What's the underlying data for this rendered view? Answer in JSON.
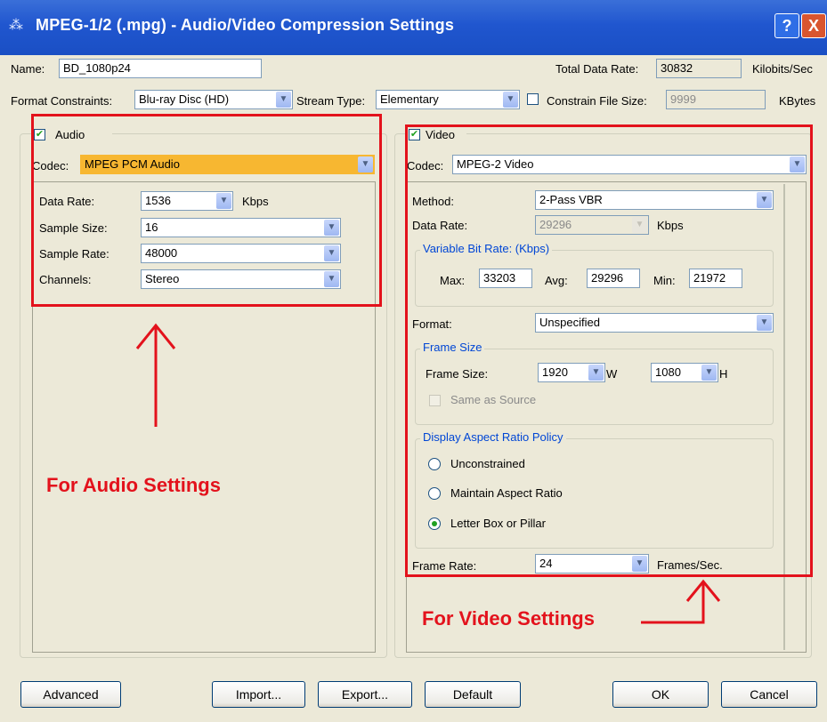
{
  "window": {
    "title": "MPEG-1/2 (.mpg) - Audio/Video Compression Settings",
    "help_label": "?",
    "close_label": "X"
  },
  "general": {
    "name_label": "Name:",
    "name_value": "BD_1080p24",
    "total_rate_label": "Total Data Rate:",
    "total_rate_value": "30832",
    "total_rate_unit": "Kilobits/Sec",
    "format_constraints_label": "Format Constraints:",
    "format_constraints_value": "Blu-ray Disc (HD)",
    "stream_type_label": "Stream Type:",
    "stream_type_value": "Elementary",
    "constrain_label": "Constrain File Size:",
    "constrain_value": "9999",
    "constrain_unit": "KBytes"
  },
  "audio": {
    "enable_label": "Audio",
    "codec_label": "Codec:",
    "codec_value": "MPEG PCM Audio",
    "data_rate_label": "Data Rate:",
    "data_rate_value": "1536",
    "data_rate_unit": "Kbps",
    "sample_size_label": "Sample Size:",
    "sample_size_value": "16",
    "sample_rate_label": "Sample Rate:",
    "sample_rate_value": "48000",
    "channels_label": "Channels:",
    "channels_value": "Stereo",
    "highlight_color": "#f7b731"
  },
  "video": {
    "enable_label": "Video",
    "codec_label": "Codec:",
    "codec_value": "MPEG-2 Video",
    "method_label": "Method:",
    "method_value": "2-Pass VBR",
    "data_rate_label": "Data Rate:",
    "data_rate_value": "29296",
    "data_rate_unit": "Kbps",
    "vbr_group": "Variable Bit Rate: (Kbps)",
    "max_label": "Max:",
    "max_value": "33203",
    "avg_label": "Avg:",
    "avg_value": "29296",
    "min_label": "Min:",
    "min_value": "21972",
    "format_label": "Format:",
    "format_value": "Unspecified",
    "frame_size_group": "Frame Size",
    "frame_size_label": "Frame Size:",
    "width_value": "1920",
    "width_unit": "W",
    "height_value": "1080",
    "height_unit": "H",
    "same_as_source_label": "Same as Source",
    "aspect_group": "Display Aspect Ratio Policy",
    "aspect_options": [
      "Unconstrained",
      "Maintain Aspect Ratio",
      "Letter Box or Pillar"
    ],
    "aspect_selected": "Letter Box or Pillar",
    "frame_rate_label": "Frame Rate:",
    "frame_rate_value": "24",
    "frame_rate_unit": "Frames/Sec."
  },
  "annotations": {
    "audio_text": "For Audio Settings",
    "video_text": "For Video Settings",
    "color": "#e3121c"
  },
  "buttons": {
    "advanced": "Advanced",
    "import": "Import...",
    "export": "Export...",
    "default": "Default",
    "ok": "OK",
    "cancel": "Cancel"
  },
  "icons": {
    "dropdown": "chevron-down-icon",
    "check": "checkmark-icon",
    "app": "app-icon"
  }
}
